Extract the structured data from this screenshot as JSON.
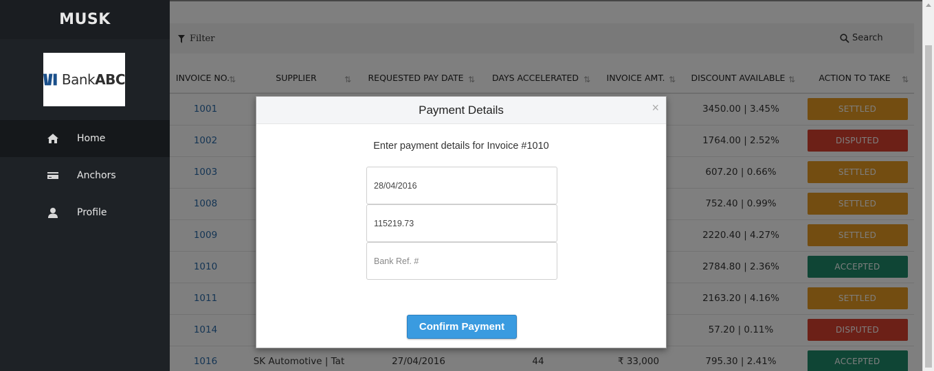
{
  "sidebar": {
    "brand": "MUSK",
    "logo": {
      "text_light": "Bank",
      "text_bold": "ABC"
    },
    "nav": [
      {
        "label": "Home",
        "icon": "home-icon",
        "active": true
      },
      {
        "label": "Anchors",
        "icon": "card-icon",
        "active": false
      },
      {
        "label": "Profile",
        "icon": "user-icon",
        "active": false
      }
    ]
  },
  "toolbar": {
    "filter_label": "Filter",
    "search_label": "Search"
  },
  "table": {
    "columns": [
      "INVOICE NO.",
      "SUPPLIER",
      "REQUESTED PAY DATE",
      "DAYS ACCELERATED",
      "INVOICE AMT.",
      "DISCOUNT AVAILABLE",
      "ACTION TO TAKE"
    ],
    "rows": [
      {
        "invoice": "1001",
        "supplier": "",
        "date": "",
        "days": "",
        "amount": "",
        "discount": "3450.00 | 3.45%",
        "action": "SETTLED"
      },
      {
        "invoice": "1002",
        "supplier": "",
        "date": "",
        "days": "",
        "amount": "",
        "discount": "1764.00 | 2.52%",
        "action": "DISPUTED"
      },
      {
        "invoice": "1003",
        "supplier": "",
        "date": "",
        "days": "",
        "amount": "",
        "discount": "607.20 | 0.66%",
        "action": "SETTLED"
      },
      {
        "invoice": "1008",
        "supplier": "",
        "date": "",
        "days": "",
        "amount": "",
        "discount": "752.40 | 0.99%",
        "action": "SETTLED"
      },
      {
        "invoice": "1009",
        "supplier": "",
        "date": "",
        "days": "",
        "amount": "",
        "discount": "2220.40 | 4.27%",
        "action": "SETTLED"
      },
      {
        "invoice": "1010",
        "supplier": "",
        "date": "",
        "days": "",
        "amount": "",
        "discount": "2784.80 | 2.36%",
        "action": "ACCEPTED"
      },
      {
        "invoice": "1011",
        "supplier": "",
        "date": "",
        "days": "",
        "amount": "",
        "discount": "2163.20 | 4.16%",
        "action": "SETTLED"
      },
      {
        "invoice": "1014",
        "supplier": "",
        "date": "",
        "days": "",
        "amount": "",
        "discount": "57.20 | 0.11%",
        "action": "DISPUTED"
      },
      {
        "invoice": "1016",
        "supplier": "SK Automotive | Tat",
        "date": "27/04/2016",
        "days": "44",
        "amount": "₹ 33,000",
        "discount": "795.30 | 2.41%",
        "action": "ACCEPTED"
      }
    ]
  },
  "modal": {
    "title": "Payment Details",
    "close": "×",
    "prompt": "Enter payment details for Invoice #1010",
    "date_value": "28/04/2016",
    "amount_value": "115219.73",
    "bank_ref_placeholder": "Bank Ref. #",
    "confirm_label": "Confirm Payment"
  },
  "colors": {
    "settled": "#e69a22",
    "disputed": "#d9412f",
    "accepted": "#1f8a6a",
    "primary": "#3a9be0",
    "sidebar": "#1e2226"
  }
}
